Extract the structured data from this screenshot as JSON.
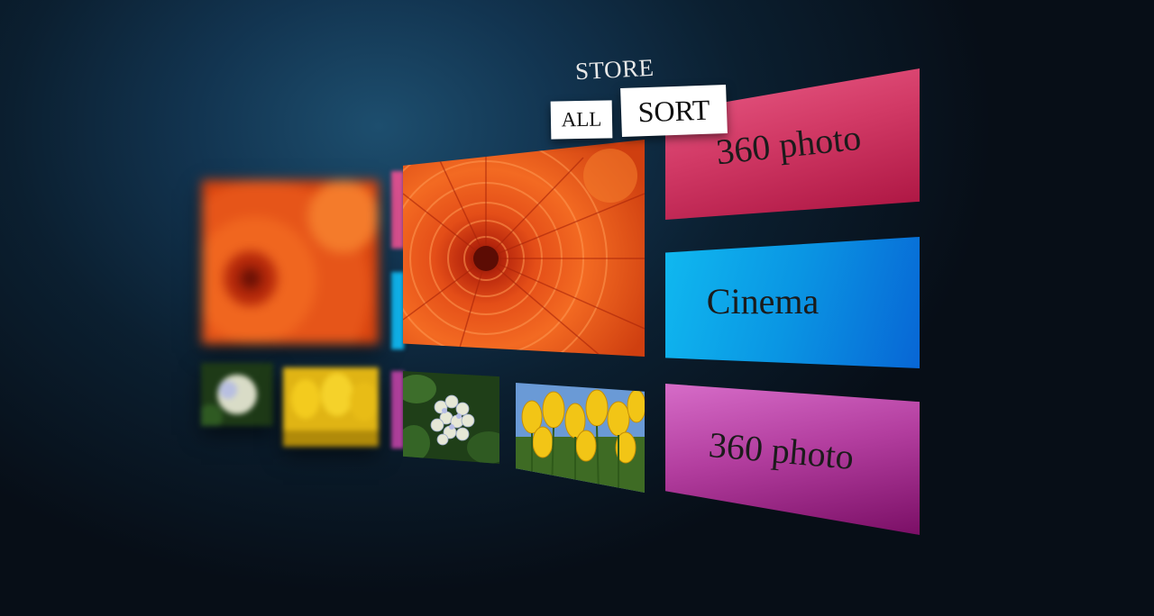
{
  "header": {
    "title": "STORE",
    "all_label": "ALL",
    "sort_label": "SORT"
  },
  "photos": [
    {
      "subject": "orange chrysanthemum",
      "focus": "blurred"
    },
    {
      "subject": "orange chrysanthemum",
      "focus": "sharp"
    },
    {
      "subject": "white hydrangea",
      "focus": "blurred"
    },
    {
      "subject": "yellow tulips",
      "focus": "blurred"
    },
    {
      "subject": "white hydrangea",
      "focus": "sharp"
    },
    {
      "subject": "yellow tulips",
      "focus": "sharp"
    }
  ],
  "tiles": [
    {
      "label": "360 photo",
      "color": "#d23a66"
    },
    {
      "label": "Cinema",
      "color": "#0a95e3"
    },
    {
      "label": "360 photo",
      "color": "#b33e9f"
    }
  ]
}
